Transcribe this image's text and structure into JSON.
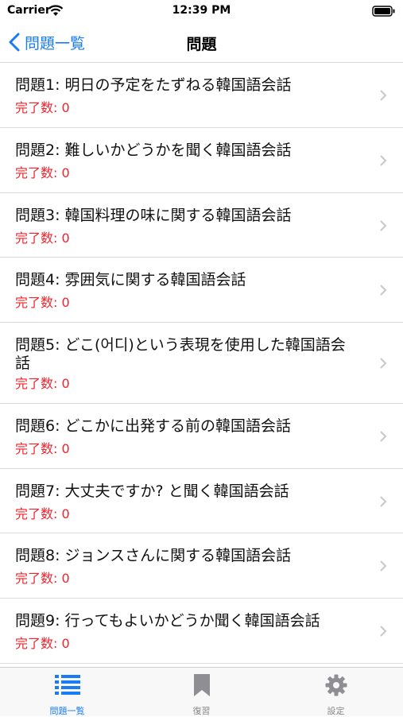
{
  "status": {
    "carrier": "Carrier",
    "time": "12:39 PM"
  },
  "nav": {
    "back_label": "問題一覧",
    "title": "問題"
  },
  "colors": {
    "accent": "#1a7cf5",
    "completion_text": "#f2222a"
  },
  "problems": [
    {
      "title": "問題1: 明日の予定をたずねる韓国語会話",
      "completion": "完了数: 0"
    },
    {
      "title": "問題2: 難しいかどうかを聞く韓国語会話",
      "completion": "完了数: 0"
    },
    {
      "title": "問題3: 韓国料理の味に関する韓国語会話",
      "completion": "完了数: 0"
    },
    {
      "title": "問題4: 雰囲気に関する韓国語会話",
      "completion": "完了数: 0"
    },
    {
      "title": "問題5: どこ(어디)という表現を使用した韓国語会話",
      "completion": "完了数: 0"
    },
    {
      "title": "問題6: どこかに出発する前の韓国語会話",
      "completion": "完了数: 0"
    },
    {
      "title": "問題7: 大丈夫ですか? と聞く韓国語会話",
      "completion": "完了数: 0"
    },
    {
      "title": "問題8: ジョンスさんに関する韓国語会話",
      "completion": "完了数: 0"
    },
    {
      "title": "問題9: 行ってもよいかどうか聞く韓国語会話",
      "completion": "完了数: 0"
    }
  ],
  "tabs": [
    {
      "label": "問題一覧",
      "icon": "list-icon",
      "active": true
    },
    {
      "label": "復習",
      "icon": "bookmark-icon",
      "active": false
    },
    {
      "label": "設定",
      "icon": "gear-icon",
      "active": false
    }
  ]
}
